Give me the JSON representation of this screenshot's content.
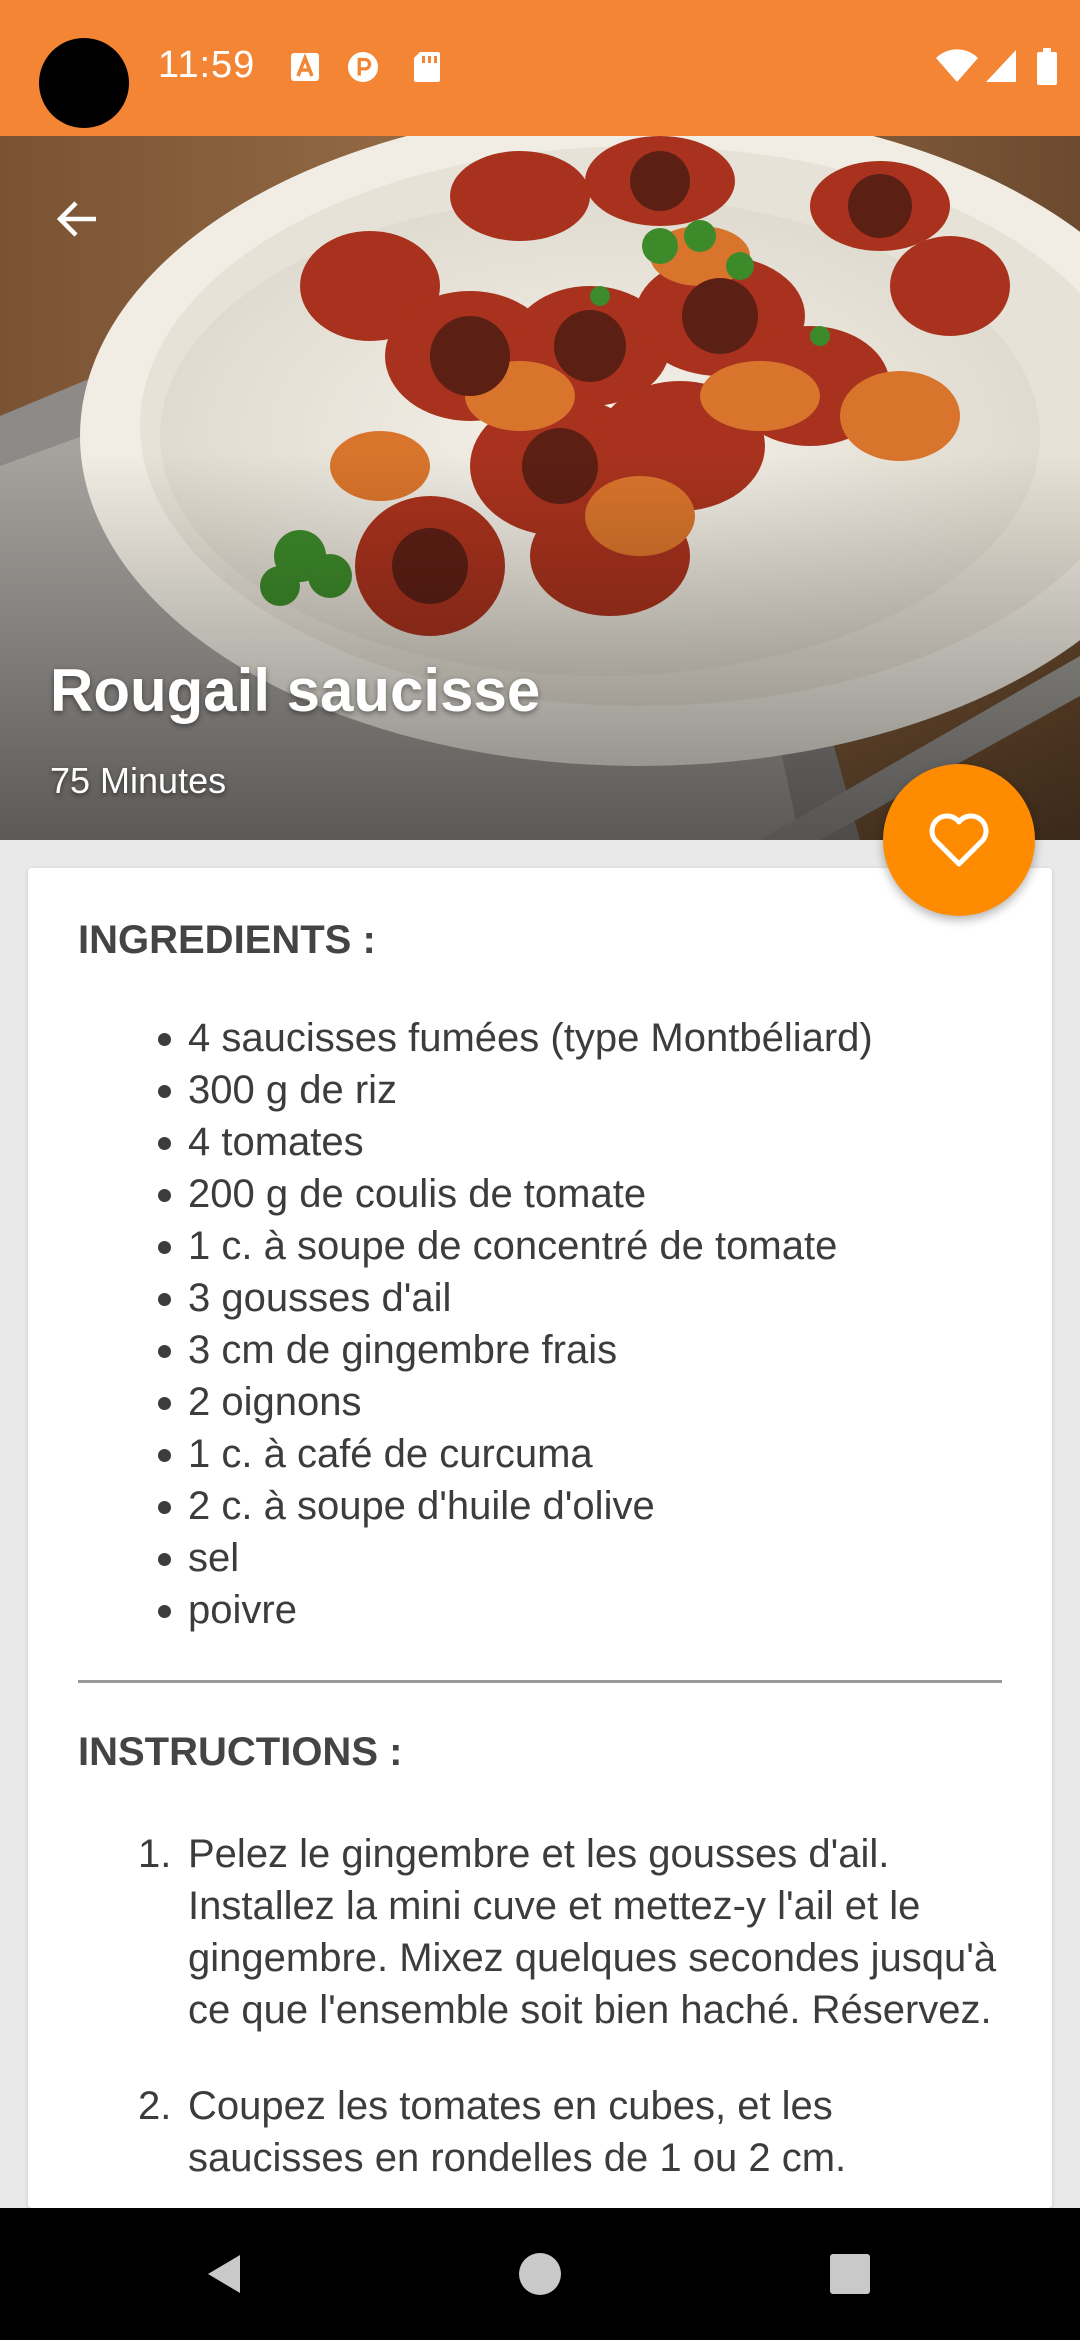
{
  "status_bar": {
    "time": "11:59",
    "notification_icons": [
      "text-a-icon",
      "circle-p-icon",
      "sd-card-icon"
    ],
    "right_icons": [
      "wifi-icon",
      "signal-icon",
      "battery-icon"
    ]
  },
  "header": {
    "back_icon": "arrow-left-icon",
    "title": "Rougail saucisse",
    "duration": "75 Minutes",
    "favorite_icon": "heart-outline-icon"
  },
  "ingredients": {
    "title": "INGREDIENTS :",
    "items": [
      "4 saucisses fumées (type Montbéliard)",
      "300 g de riz",
      "4 tomates",
      "200 g de coulis de tomate",
      "1 c. à soupe de concentré de tomate",
      "3 gousses d'ail",
      "3 cm de gingembre frais",
      "2 oignons",
      "1 c. à café de curcuma",
      "2 c. à soupe d'huile d'olive",
      "sel",
      "poivre"
    ]
  },
  "instructions": {
    "title": "INSTRUCTIONS :",
    "steps": [
      {
        "num": "1.",
        "text": "Pelez le gingembre et les gousses d'ail. Installez la mini cuve et mettez-y l'ail et le gingembre. Mixez quelques secondes jusqu'à ce que l'ensemble soit bien haché. Réservez."
      },
      {
        "num": "2.",
        "text": "Coupez les tomates en cubes, et les saucisses en rondelles de 1 ou 2 cm."
      }
    ]
  },
  "nav_bar": {
    "buttons": [
      "back-triangle-icon",
      "home-circle-icon",
      "recents-square-icon"
    ]
  },
  "colors": {
    "status_bar": "#f38535",
    "fab": "#ff8c00",
    "card": "#ffffff",
    "background": "#e9e9e9"
  }
}
